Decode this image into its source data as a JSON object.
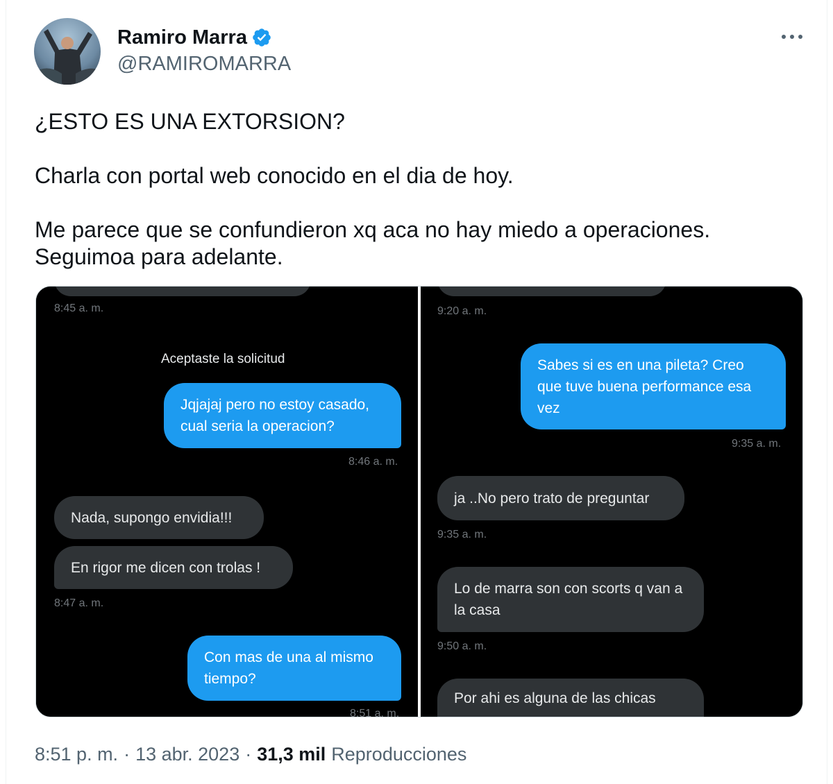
{
  "author": {
    "name": "Ramiro Marra",
    "handle": "@RAMIROMARRA",
    "verified_color": "#1d9bf0"
  },
  "icons": {
    "verified": "verified-badge-icon",
    "more": "more-options-icon"
  },
  "tweet": {
    "paragraphs": [
      "¿ESTO ES UNA EXTORSION?",
      "Charla con portal web conocido en el dia de hoy.",
      "Me parece que se confundieron xq aca no hay miedo a operaciones. Seguimoa para adelante."
    ]
  },
  "media": {
    "left": {
      "ts_top": "8:45 a. m.",
      "system_note": "Aceptaste la solicitud",
      "msg1": "Jqjajaj pero no estoy casado, cual seria la operacion?",
      "ts1": "8:46 a. m.",
      "msg2": "Nada, supongo envidia!!!",
      "msg3": "En rigor me dicen con trolas !",
      "ts2": "8:47 a. m.",
      "msg4": "Con mas de una al mismo tiempo?",
      "ts3": "8:51 a. m."
    },
    "right": {
      "ts_top": "9:20 a. m.",
      "msg1": "Sabes si es en una pileta?  Creo que tuve buena performance esa vez",
      "ts1": "9:35 a. m.",
      "msg2": "ja ..No pero trato de preguntar",
      "ts2": "9:35 a. m.",
      "msg3": "Lo de marra son con scorts q van a la casa",
      "ts3": "9:50 a. m.",
      "msg4": "Por ahi es alguna de las chicas"
    },
    "colors": {
      "outgoing": "#1d9bf0",
      "incoming": "#2f3336",
      "background": "#000000"
    }
  },
  "footer": {
    "time": "8:51 p. m.",
    "sep": "·",
    "date": "13 abr. 2023",
    "views_count": "31,3 mil",
    "views_label": "Reproducciones"
  }
}
